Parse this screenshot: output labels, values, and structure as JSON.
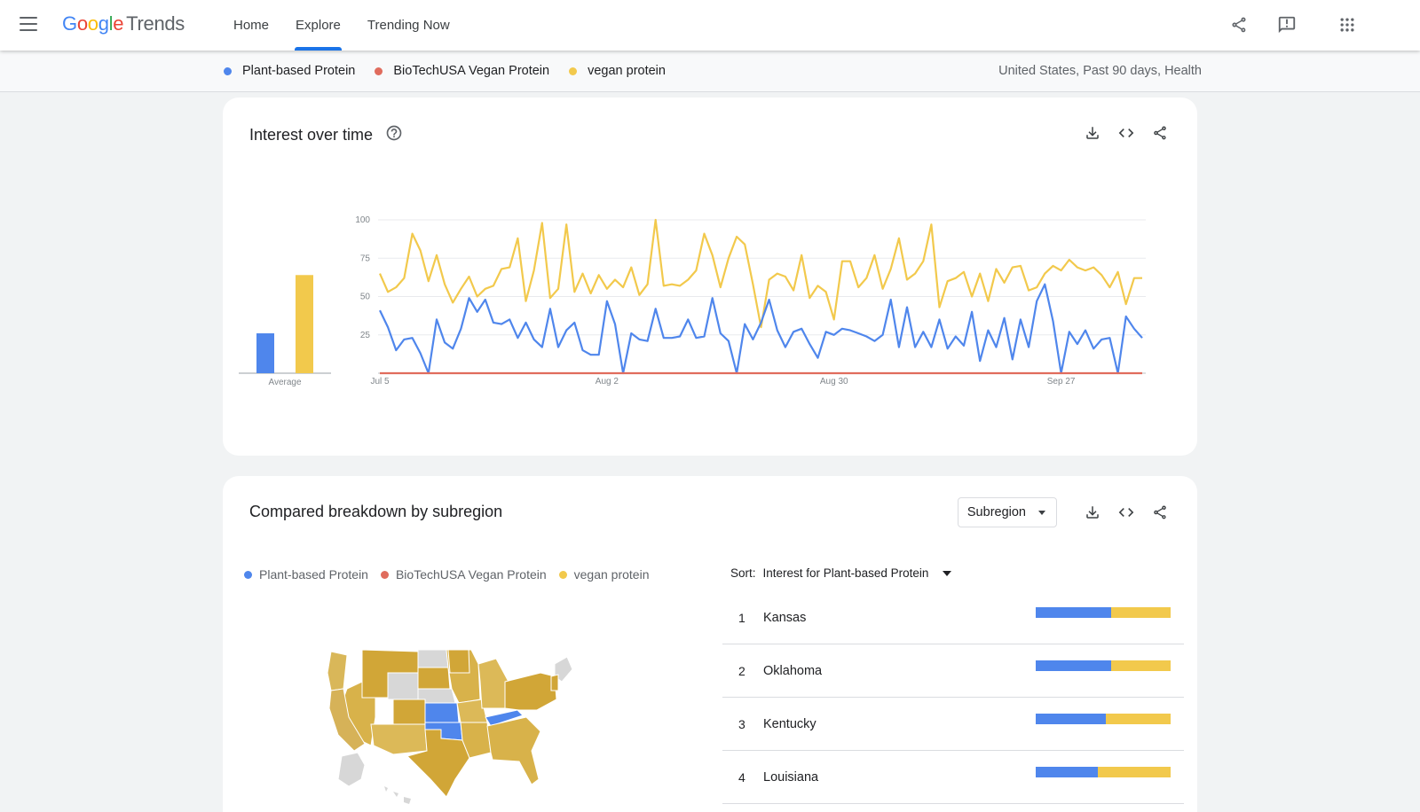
{
  "header": {
    "logo": {
      "google": [
        "G",
        "o",
        "o",
        "g",
        "l",
        "e"
      ],
      "trends": "Trends"
    },
    "nav": [
      {
        "label": "Home",
        "active": false
      },
      {
        "label": "Explore",
        "active": true
      },
      {
        "label": "Trending Now",
        "active": false
      }
    ]
  },
  "subbar": {
    "terms": [
      {
        "label": "Plant-based Protein",
        "color": "#4f86ec"
      },
      {
        "label": "BioTechUSA Vegan Protein",
        "color": "#e06c5d"
      },
      {
        "label": "vegan protein",
        "color": "#f2c94c"
      }
    ],
    "context": "United States, Past 90 days, Health"
  },
  "interest": {
    "title": "Interest over time",
    "average_label": "Average"
  },
  "chart_data": {
    "type": "line",
    "x_tick_labels": [
      "Jul 5",
      "Aug 2",
      "Aug 30",
      "Sep 27"
    ],
    "y_ticks": [
      25,
      50,
      75,
      100
    ],
    "ylim": [
      0,
      100
    ],
    "averages": [
      {
        "name": "Plant-based Protein",
        "value": 26,
        "color": "#4f86ec"
      },
      {
        "name": "BioTechUSA Vegan Protein",
        "value": 0,
        "color": "#e06c5d"
      },
      {
        "name": "vegan protein",
        "value": 64,
        "color": "#f2c94c"
      }
    ],
    "series": [
      {
        "name": "Plant-based Protein",
        "color": "#4f86ec",
        "values": [
          41,
          30,
          15,
          22,
          23,
          13,
          0,
          35,
          20,
          16,
          29,
          49,
          40,
          48,
          33,
          32,
          35,
          23,
          33,
          22,
          17,
          42,
          17,
          28,
          33,
          15,
          12,
          12,
          47,
          32,
          0,
          26,
          22,
          21,
          42,
          23,
          23,
          24,
          35,
          23,
          24,
          49,
          26,
          21,
          0,
          32,
          22,
          33,
          48,
          28,
          17,
          27,
          29,
          19,
          10,
          27,
          25,
          29,
          28,
          26,
          24,
          21,
          25,
          48,
          17,
          43,
          17,
          27,
          17,
          35,
          16,
          24,
          18,
          40,
          8,
          28,
          17,
          36,
          9,
          35,
          17,
          47,
          58,
          34,
          0,
          27,
          19,
          28,
          16,
          22,
          23,
          0,
          37,
          29,
          23
        ]
      },
      {
        "name": "BioTechUSA Vegan Protein",
        "color": "#e06c5d",
        "values": [
          0,
          0,
          0,
          0,
          0,
          0,
          0,
          0,
          0,
          0,
          0,
          0,
          0,
          0,
          0,
          0,
          0,
          0,
          0,
          0,
          0,
          0,
          0,
          0,
          0,
          0,
          0,
          0,
          0,
          0,
          0,
          0,
          0,
          0,
          0,
          0,
          0,
          0,
          0,
          0,
          0,
          0,
          0,
          0,
          0,
          0,
          0,
          0,
          0,
          0,
          0,
          0,
          0,
          0,
          0,
          0,
          0,
          0,
          0,
          0,
          0,
          0,
          0,
          0,
          0,
          0,
          0,
          0,
          0,
          0,
          0,
          0,
          0,
          0,
          0,
          0,
          0,
          0,
          0,
          0,
          0,
          0,
          0,
          0,
          0,
          0,
          0,
          0,
          0,
          0,
          0,
          0,
          0,
          0,
          0
        ]
      },
      {
        "name": "vegan protein",
        "color": "#f2c94c",
        "values": [
          65,
          53,
          56,
          62,
          91,
          80,
          60,
          77,
          58,
          46,
          55,
          63,
          50,
          55,
          57,
          68,
          69,
          88,
          47,
          67,
          98,
          49,
          55,
          97,
          53,
          65,
          52,
          64,
          55,
          61,
          56,
          69,
          51,
          58,
          100,
          57,
          58,
          57,
          61,
          67,
          91,
          77,
          56,
          75,
          89,
          84,
          58,
          30,
          61,
          65,
          63,
          54,
          77,
          49,
          57,
          53,
          35,
          73,
          73,
          56,
          62,
          77,
          55,
          68,
          88,
          61,
          65,
          73,
          97,
          43,
          60,
          62,
          66,
          50,
          65,
          47,
          68,
          59,
          69,
          70,
          54,
          56,
          65,
          70,
          67,
          74,
          69,
          67,
          69,
          64,
          56,
          66,
          45,
          62,
          62
        ]
      }
    ]
  },
  "breakdown": {
    "title": "Compared breakdown by subregion",
    "dropdown": "Subregion",
    "legend": [
      {
        "label": "Plant-based Protein",
        "color": "#4f86ec"
      },
      {
        "label": "BioTechUSA Vegan Protein",
        "color": "#e06c5d"
      },
      {
        "label": "vegan protein",
        "color": "#f2c94c"
      }
    ],
    "sort_label": "Sort:",
    "sort_value": "Interest for Plant-based Protein",
    "rows": [
      {
        "rank": "1",
        "name": "Kansas",
        "blue": 0.56,
        "yellow": 0.44
      },
      {
        "rank": "2",
        "name": "Oklahoma",
        "blue": 0.56,
        "yellow": 0.44
      },
      {
        "rank": "3",
        "name": "Kentucky",
        "blue": 0.52,
        "yellow": 0.48
      },
      {
        "rank": "4",
        "name": "Louisiana",
        "blue": 0.46,
        "yellow": 0.54
      }
    ]
  }
}
